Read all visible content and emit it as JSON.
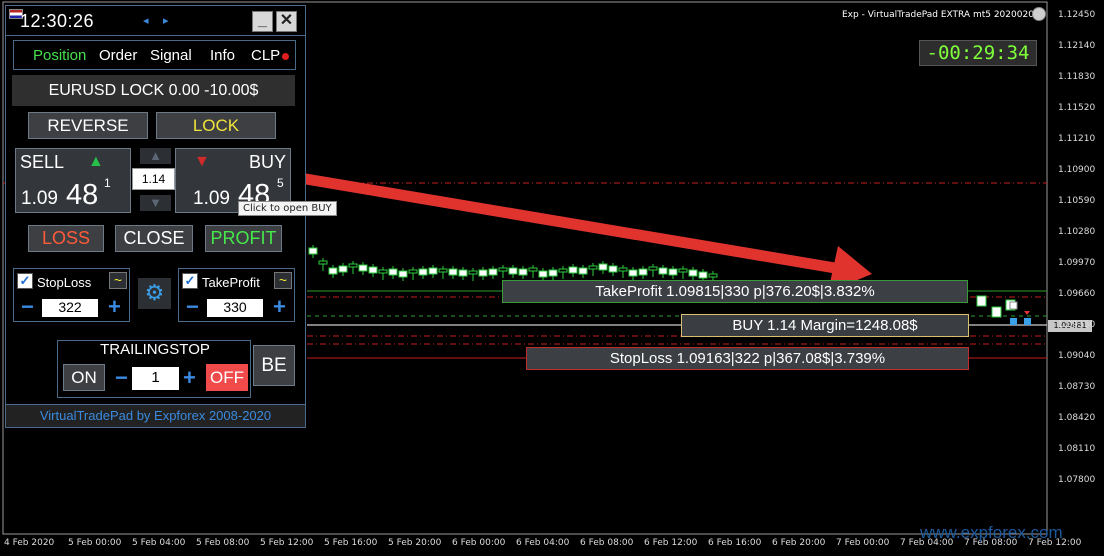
{
  "panel": {
    "clock": "12:30:26",
    "prev_arrow": "◂",
    "next_arrow": "▸",
    "minimize": "_",
    "close": "✕",
    "tabs": [
      "Position",
      "Order",
      "Signal",
      "Info",
      "CLP"
    ],
    "active_tab": "Position",
    "summary": "EURUSD LOCK 0.00 -10.00$",
    "reverse": "REVERSE",
    "lock": "LOCK",
    "sell": {
      "label": "SELL",
      "price_small": "1.09",
      "price_big": "48",
      "price_sup": "1"
    },
    "buy": {
      "label": "BUY",
      "price_small": "1.09",
      "price_big": "48",
      "price_sup": "5"
    },
    "lot": "1.14",
    "tooltip": "Click to open BUY",
    "loss": "LOSS",
    "close_btn": "CLOSE",
    "profit": "PROFIT",
    "stoploss": {
      "label": "StopLoss",
      "value": "322"
    },
    "takeprofit": {
      "label": "TakeProfit",
      "value": "330"
    },
    "trailing": {
      "title": "TRAILINGSTOP",
      "on": "ON",
      "value": "1",
      "off": "OFF"
    },
    "be": "BE",
    "footer": "VirtualTradePad by Expforex 2008-2020"
  },
  "chart": {
    "ea_title": "Exp - VirtualTradePad EXTRA mt5 20200206",
    "timer": "-00:29:34",
    "current_price": "1.09481",
    "tp_label": "TakeProfit 1.09815|330 p|376.20$|3.832%",
    "buy_label": "BUY 1.14 Margin=1248.08$",
    "sl_label": "StopLoss 1.09163|322 p|367.08$|3.739%",
    "watermark": "www.expforex.com",
    "price_axis": [
      "1.12450",
      "1.12140",
      "1.11830",
      "1.11520",
      "1.11210",
      "1.10900",
      "1.10590",
      "1.10280",
      "1.09970",
      "1.09660",
      "1.09350",
      "1.09040",
      "1.08730",
      "1.08420",
      "1.08110",
      "1.07800"
    ],
    "date_axis": [
      "4 Feb 2020",
      "5 Feb 00:00",
      "5 Feb 04:00",
      "5 Feb 08:00",
      "5 Feb 12:00",
      "5 Feb 16:00",
      "5 Feb 20:00",
      "6 Feb 00:00",
      "6 Feb 04:00",
      "6 Feb 08:00",
      "6 Feb 12:00",
      "6 Feb 16:00",
      "6 Feb 20:00",
      "7 Feb 00:00",
      "7 Feb 04:00",
      "7 Feb 08:00",
      "7 Feb 12:00"
    ],
    "colors": {
      "bull": "#ffffff",
      "bear": "#000000",
      "wick": "#2ecc40",
      "tp_line": "#2e9e2e",
      "sl_line": "#c81e1e",
      "arrow": "#e0332d"
    }
  }
}
